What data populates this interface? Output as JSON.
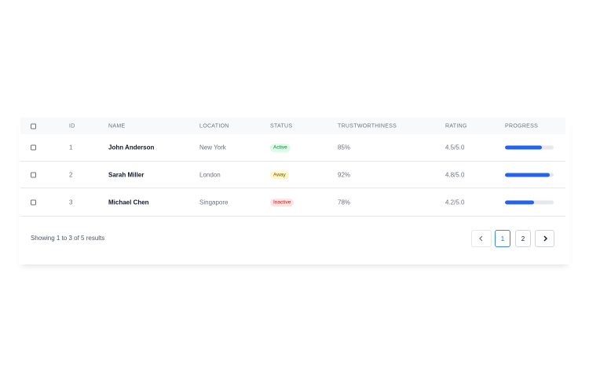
{
  "table": {
    "headers": {
      "id": "ID",
      "name": "NAME",
      "location": "LOCATION",
      "status": "STATUS",
      "trust": "TRUSTWORTHINESS",
      "rating": "RATING",
      "progress": "PROGRESS"
    },
    "rows": [
      {
        "id": "1",
        "name": "John Anderson",
        "location": "New York",
        "status": "Active",
        "trust": "85%",
        "rating": "4.5/5.0",
        "progress": 0.76
      },
      {
        "id": "2",
        "name": "Sarah Miller",
        "location": "London",
        "status": "Away",
        "trust": "92%",
        "rating": "4.8/5.0",
        "progress": 0.92
      },
      {
        "id": "3",
        "name": "Michael Chen",
        "location": "Singapore",
        "status": "Inactive",
        "trust": "78%",
        "rating": "4.2/5.0",
        "progress": 0.6
      }
    ]
  },
  "status_colors": {
    "Active": {
      "bg": "#dcfce7",
      "fg": "#15803d"
    },
    "Away": {
      "bg": "#fef9c3",
      "fg": "#854d0e"
    },
    "Inactive": {
      "bg": "#fee2e2",
      "fg": "#b91c1c"
    }
  },
  "footer": {
    "summary": "Showing 1 to 3 of 5 results"
  },
  "pagination": {
    "prev_icon": "chevron-left-icon",
    "pages": [
      "1",
      "2"
    ],
    "current": "1",
    "next_icon": "chevron-right-icon"
  },
  "colors": {
    "accent": "#2563eb"
  }
}
